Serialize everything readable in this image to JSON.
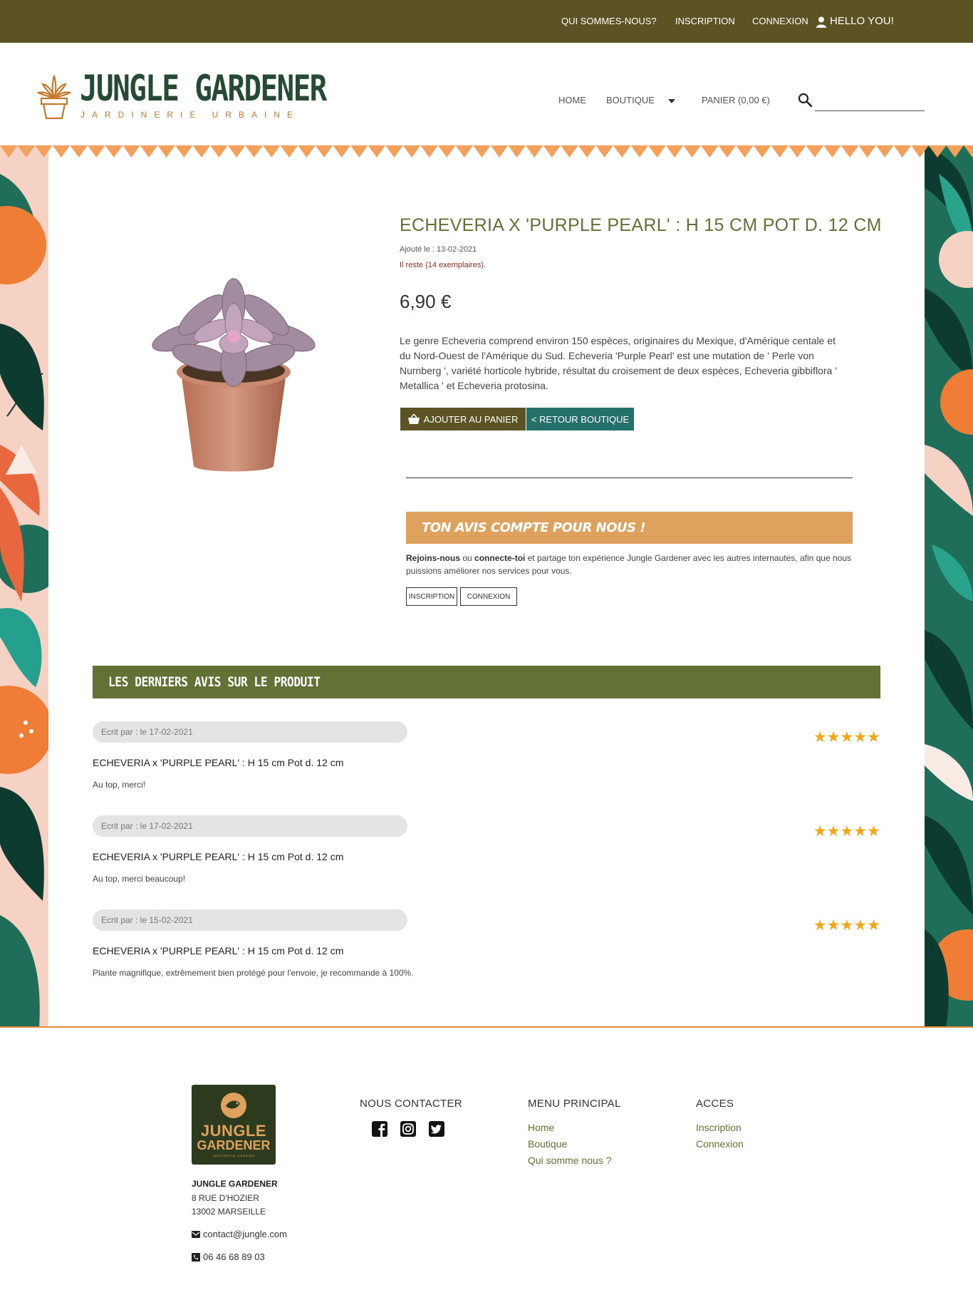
{
  "topbar": {
    "links": [
      "QUI SOMMES-NOUS?",
      "INSCRIPTION",
      "CONNEXION"
    ],
    "hello": "HELLO YOU!"
  },
  "header": {
    "logo_title": "JUNGLE GARDENER",
    "logo_subtitle": "JARDINERIE URBAINE",
    "nav": {
      "home": "HOME",
      "shop": "BOUTIQUE",
      "cart": "PANIER (0,00 €)"
    },
    "search_value": ""
  },
  "product": {
    "title": "ECHEVERIA X 'PURPLE PEARL' : H 15 CM POT D. 12 CM",
    "added": "Ajouté le : 13-02-2021",
    "stock": "Il reste (14 exemplaires).",
    "price": "6,90 €",
    "description": "Le genre Echeveria comprend environ 150 espèces, originaires du Mexique, d'Amérique centale et du Nord-Ouest de l'Amérique du Sud. Echeveria 'Purple Pearl' est une mutation de ' Perle von Nurnberg ', variété horticole hybride, résultat du croisement de deux espèces, Echeveria gibbiflora ' Metallica ' et Echeveria protosina.",
    "add_to_cart": "AJOUTER AU PANIER",
    "back_to_shop": "< RETOUR BOUTIQUE"
  },
  "avis": {
    "title": "TON AVIS COMPTE POUR NOUS !",
    "join": "Rejoins-nous",
    "or": " ou ",
    "connect": "connecte-toi",
    "text": " et partage ton expérience Jungle Gardener avec les autres internautes, afin que nous puissions améliorer nos services pour vous.",
    "btn_inscription": "INSCRIPTION",
    "btn_connexion": "CONNEXION"
  },
  "reviews": {
    "title": "LES DERNIERS AVIS SUR LE PRODUIT",
    "items": [
      {
        "meta": "Ecrit par : le 17-02-2021",
        "rating": 5,
        "stars": "★★★★★",
        "product": "ECHEVERIA x 'PURPLE PEARL' : H 15 cm Pot d. 12 cm",
        "text": "Au top, merci!"
      },
      {
        "meta": "Ecrit par : le 17-02-2021",
        "rating": 5,
        "stars": "★★★★★",
        "product": "ECHEVERIA x 'PURPLE PEARL' : H 15 cm Pot d. 12 cm",
        "text": "Au top, merci beaucoup!"
      },
      {
        "meta": "Ecrit par : le 15-02-2021",
        "rating": 5,
        "stars": "★★★★★",
        "product": "ECHEVERIA x 'PURPLE PEARL' : H 15 cm Pot d. 12 cm",
        "text": "Plante magnifique, extrêmement bien protégé pour l'envoie, je recommande à 100%."
      }
    ]
  },
  "footer": {
    "logo_line1": "JUNGLE",
    "logo_line2": "GARDENER",
    "logo_line3": "JARDINERIE URBAINE",
    "company": "JUNGLE GARDENER",
    "address1": "8 RUE D'HOZIER",
    "address2": "13002 MARSEILLE",
    "email": "contact@jungle.com",
    "phone": "06 46 68 89 03",
    "contact_heading": "NOUS CONTACTER",
    "menu_heading": "MENU PRINCIPAL",
    "menu_links": [
      "Home",
      "Boutique",
      "Qui somme nous ?"
    ],
    "access_heading": "ACCES",
    "access_links": [
      "Inscription",
      "Connexion"
    ]
  },
  "colors": {
    "topbar": "#5b5323",
    "brand_green": "#627234",
    "accent_orange": "#dea25e",
    "teal_button": "#25706b",
    "star": "#f3a61a"
  },
  "icons": [
    "user-icon",
    "search-icon",
    "basket-icon",
    "facebook-icon",
    "instagram-icon",
    "twitter-icon",
    "email-icon",
    "phone-icon"
  ]
}
